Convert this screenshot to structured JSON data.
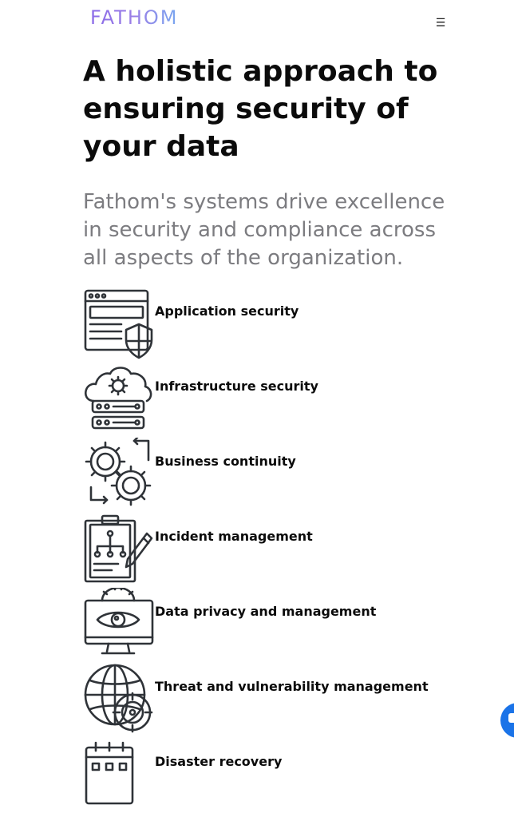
{
  "header": {
    "logo_text": "FATHOM",
    "menu_icon": "hamburger-icon",
    "menu_glyph": "☰"
  },
  "hero": {
    "title": "A holistic approach to ensuring security of your data",
    "subtitle": "Fathom's systems drive excellence in security and compliance across all aspects of the organization."
  },
  "features": [
    {
      "icon": "browser-shield-icon",
      "label": "Application security"
    },
    {
      "icon": "cloud-server-icon",
      "label": "Infrastructure security"
    },
    {
      "icon": "gears-cycle-icon",
      "label": "Business continuity"
    },
    {
      "icon": "clipboard-pen-icon",
      "label": "Incident management"
    },
    {
      "icon": "monitor-eye-icon",
      "label": "Data privacy and management"
    },
    {
      "icon": "globe-target-icon",
      "label": "Threat and vulnerability management"
    },
    {
      "icon": "calendar-icon",
      "label": "Disaster recovery"
    }
  ],
  "chat": {
    "icon": "chat-icon"
  },
  "colors": {
    "text": "#0b0b0b",
    "subtitle": "#7c7c80",
    "logo_start": "#8b6be8",
    "logo_end": "#7aa7f0",
    "chat": "#1a73e8"
  }
}
